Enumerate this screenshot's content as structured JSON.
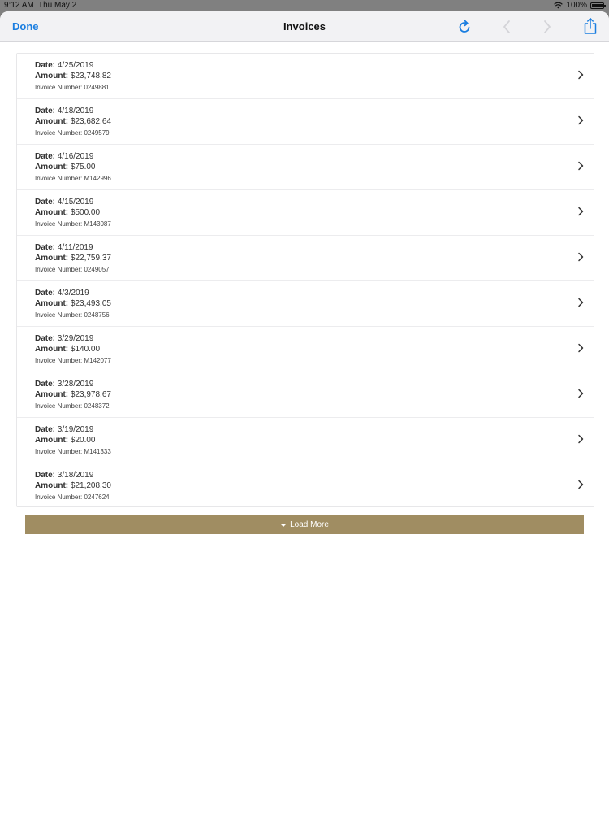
{
  "status": {
    "time": "9:12 AM",
    "date": "Thu May 2",
    "battery": "100%"
  },
  "nav": {
    "done_label": "Done",
    "title": "Invoices"
  },
  "invoices": [
    {
      "date_label": "Date:",
      "date": "4/25/2019",
      "amount_label": "Amount:",
      "amount": "$23,748.82",
      "number": "Invoice Number: 0249881"
    },
    {
      "date_label": "Date:",
      "date": "4/18/2019",
      "amount_label": "Amount:",
      "amount": "$23,682.64",
      "number": "Invoice Number: 0249579"
    },
    {
      "date_label": "Date:",
      "date": "4/16/2019",
      "amount_label": "Amount:",
      "amount": "$75.00",
      "number": "Invoice Number: M142996"
    },
    {
      "date_label": "Date:",
      "date": "4/15/2019",
      "amount_label": "Amount:",
      "amount": "$500.00",
      "number": "Invoice Number: M143087"
    },
    {
      "date_label": "Date:",
      "date": "4/11/2019",
      "amount_label": "Amount:",
      "amount": "$22,759.37",
      "number": "Invoice Number: 0249057"
    },
    {
      "date_label": "Date:",
      "date": "4/3/2019",
      "amount_label": "Amount:",
      "amount": "$23,493.05",
      "number": "Invoice Number: 0248756"
    },
    {
      "date_label": "Date:",
      "date": "3/29/2019",
      "amount_label": "Amount:",
      "amount": "$140.00",
      "number": "Invoice Number: M142077"
    },
    {
      "date_label": "Date:",
      "date": "3/28/2019",
      "amount_label": "Amount:",
      "amount": "$23,978.67",
      "number": "Invoice Number: 0248372"
    },
    {
      "date_label": "Date:",
      "date": "3/19/2019",
      "amount_label": "Amount:",
      "amount": "$20.00",
      "number": "Invoice Number: M141333"
    },
    {
      "date_label": "Date:",
      "date": "3/18/2019",
      "amount_label": "Amount:",
      "amount": "$21,208.30",
      "number": "Invoice Number: 0247624"
    }
  ],
  "load_more": {
    "label": "Load More"
  },
  "colors": {
    "accent": "#1a7ee0",
    "load_more_bg": "#a08d62"
  },
  "icons": {
    "refresh": "refresh-icon",
    "back": "chevron-left-icon",
    "forward": "chevron-right-icon",
    "share": "share-icon",
    "row_chevron": "chevron-right-icon"
  }
}
